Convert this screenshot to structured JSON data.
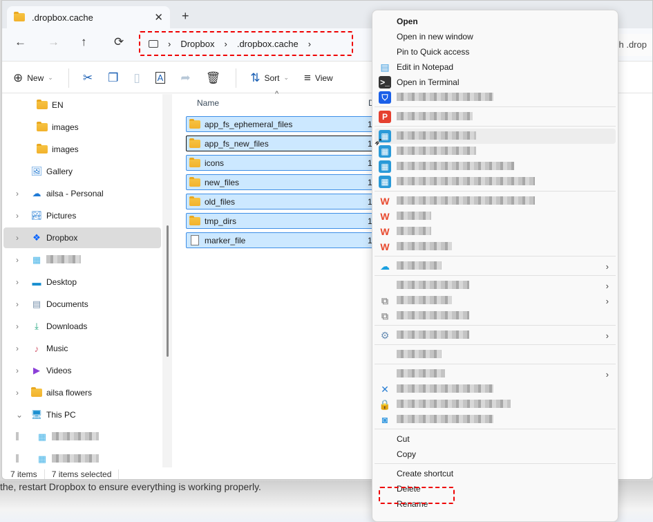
{
  "background_text": "the, restart Dropbox to ensure everything is working properly.",
  "tab": {
    "title": ".dropbox.cache",
    "close": "✕",
    "new_tab": "+"
  },
  "nav": {
    "back": "←",
    "forward": "→",
    "up": "↑",
    "refresh": "⟳"
  },
  "address": {
    "segments": [
      "Dropbox",
      ".dropbox.cache"
    ],
    "separator": "›"
  },
  "search": {
    "placeholder": "ch .drop"
  },
  "toolbar": {
    "new_label": "New",
    "sort_label": "Sort",
    "view_label": "View"
  },
  "sidebar": {
    "items": [
      {
        "label": "EN",
        "icon": "folder",
        "indent": 2
      },
      {
        "label": "images",
        "icon": "folder",
        "indent": 2
      },
      {
        "label": "images",
        "icon": "folder",
        "indent": 2
      },
      {
        "label": "Gallery",
        "icon": "gallery",
        "indent": 1
      },
      {
        "label": "ailsa - Personal",
        "icon": "onedrive",
        "indent": 1,
        "chevron": "›"
      },
      {
        "label": "Pictures",
        "icon": "pictures",
        "indent": 1,
        "chevron": "›"
      },
      {
        "label": "Dropbox",
        "icon": "dropbox",
        "indent": 1,
        "chevron": "›",
        "selected": true
      },
      {
        "label": "",
        "icon": "blurred",
        "indent": 1,
        "chevron": "›",
        "blurred": true
      },
      {
        "label": "Desktop",
        "icon": "desktop",
        "indent": 1,
        "chevron": "›"
      },
      {
        "label": "Documents",
        "icon": "documents",
        "indent": 1,
        "chevron": "›"
      },
      {
        "label": "Downloads",
        "icon": "downloads",
        "indent": 1,
        "chevron": "›"
      },
      {
        "label": "Music",
        "icon": "music",
        "indent": 1,
        "chevron": "›"
      },
      {
        "label": "Videos",
        "icon": "videos",
        "indent": 1,
        "chevron": "›"
      },
      {
        "label": "ailsa flowers",
        "icon": "folder",
        "indent": 1,
        "chevron": "›"
      },
      {
        "label": "This PC",
        "icon": "this-pc",
        "indent": 1,
        "chevron": "⌄"
      },
      {
        "label": "",
        "icon": "blurred",
        "indent": 2,
        "blurred": true
      },
      {
        "label": "",
        "icon": "blurred",
        "indent": 2,
        "blurred": true
      }
    ]
  },
  "files": {
    "columns": {
      "name": "Name",
      "date": "D"
    },
    "rows": [
      {
        "name": "app_fs_ephemeral_files",
        "type": "folder",
        "date": "1"
      },
      {
        "name": "app_fs_new_files",
        "type": "folder",
        "date": "1",
        "focused": true
      },
      {
        "name": "icons",
        "type": "folder",
        "date": "1"
      },
      {
        "name": "new_files",
        "type": "folder",
        "date": "1"
      },
      {
        "name": "old_files",
        "type": "folder",
        "date": "1"
      },
      {
        "name": "tmp_dirs",
        "type": "folder",
        "date": "1"
      },
      {
        "name": "marker_file",
        "type": "file",
        "date": "1"
      }
    ]
  },
  "status": {
    "count": "7 items",
    "selected": "7 items selected"
  },
  "context_menu": {
    "items": [
      {
        "label": "Open",
        "bold": true
      },
      {
        "label": "Open in new window"
      },
      {
        "label": "Pin to Quick access"
      },
      {
        "label": "Edit in Notepad",
        "icon": "notepad"
      },
      {
        "label": "Open in Terminal",
        "icon": "terminal"
      },
      {
        "blurred": true,
        "icon": "shield"
      },
      {
        "sep": true
      },
      {
        "blurred": true,
        "icon": "p-app"
      },
      {
        "sep": true
      },
      {
        "blurred": true,
        "icon": "winrar",
        "hover": true
      },
      {
        "blurred": true,
        "icon": "winrar"
      },
      {
        "blurred": true,
        "icon": "winrar"
      },
      {
        "blurred": true,
        "icon": "winrar"
      },
      {
        "sep": true
      },
      {
        "blurred": true,
        "icon": "wps"
      },
      {
        "blurred": true,
        "icon": "wps"
      },
      {
        "blurred": true,
        "icon": "wps"
      },
      {
        "blurred": true,
        "icon": "wps"
      },
      {
        "sep": true
      },
      {
        "blurred": true,
        "icon": "cloud",
        "submenu": true
      },
      {
        "sep": true
      },
      {
        "blurred": true,
        "submenu": true
      },
      {
        "blurred": true,
        "icon": "share",
        "submenu": true
      },
      {
        "blurred": true,
        "icon": "share"
      },
      {
        "sep": true
      },
      {
        "blurred": true,
        "icon": "network",
        "submenu": true
      },
      {
        "sep": true
      },
      {
        "blurred": true
      },
      {
        "sep": true
      },
      {
        "blurred": true,
        "submenu": true
      },
      {
        "blurred": true,
        "icon": "doc-x"
      },
      {
        "blurred": true,
        "icon": "doc-lock"
      },
      {
        "blurred": true,
        "icon": "disk"
      },
      {
        "sep": true
      },
      {
        "label": "Cut"
      },
      {
        "label": "Copy"
      },
      {
        "sep": true
      },
      {
        "label": "Create shortcut"
      },
      {
        "label": "Delete",
        "highlighted": true
      },
      {
        "label": "Rename"
      }
    ]
  },
  "colors": {
    "selection": "#cce8ff",
    "selection_border": "#3d8ee6",
    "annotation": "#ee0000"
  }
}
